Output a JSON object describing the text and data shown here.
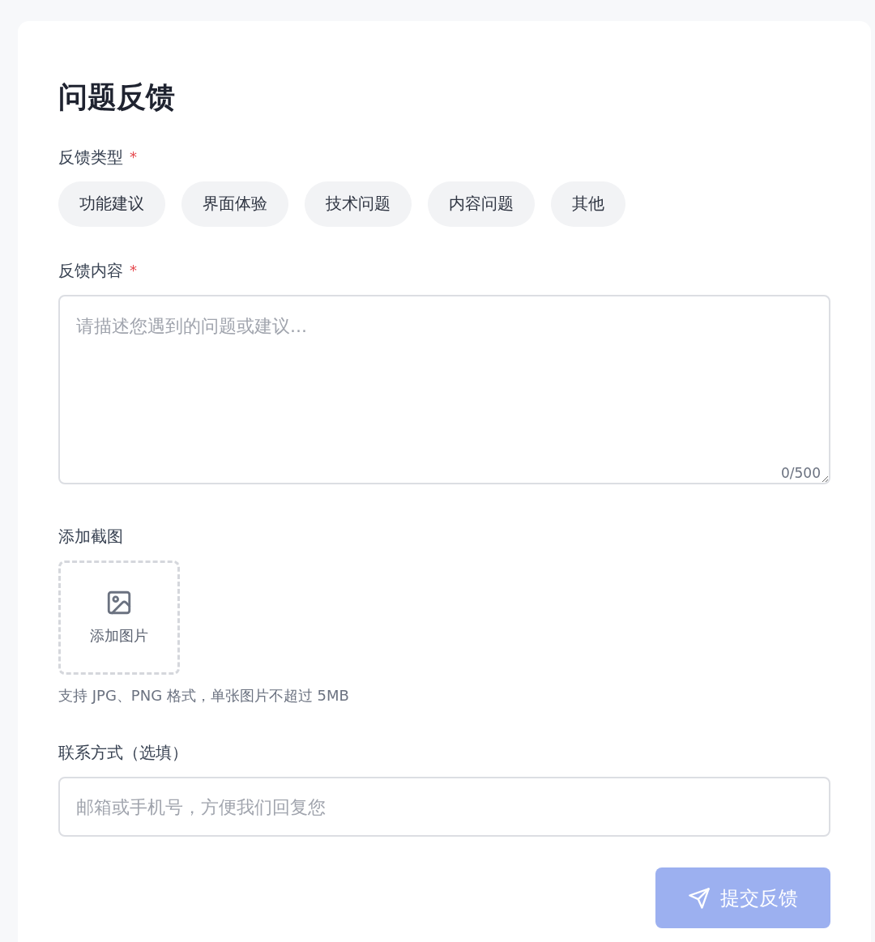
{
  "title": "问题反馈",
  "feedback_type": {
    "label": "反馈类型",
    "required_mark": "*",
    "options": [
      {
        "label": "功能建议",
        "selected": false
      },
      {
        "label": "界面体验",
        "selected": false
      },
      {
        "label": "技术问题",
        "selected": false
      },
      {
        "label": "内容问题",
        "selected": false
      },
      {
        "label": "其他",
        "selected": false
      }
    ]
  },
  "content": {
    "label": "反馈内容",
    "required_mark": "*",
    "placeholder": "请描述您遇到的问题或建议...",
    "counter": "0/500"
  },
  "screenshot": {
    "label": "添加截图",
    "upload_label": "添加图片",
    "hint": "支持 JPG、PNG 格式，单张图片不超过 5MB"
  },
  "contact": {
    "label": "联系方式（选填）",
    "placeholder": "邮箱或手机号，方便我们回复您"
  },
  "submit": {
    "label": "提交反馈",
    "disabled": true
  }
}
